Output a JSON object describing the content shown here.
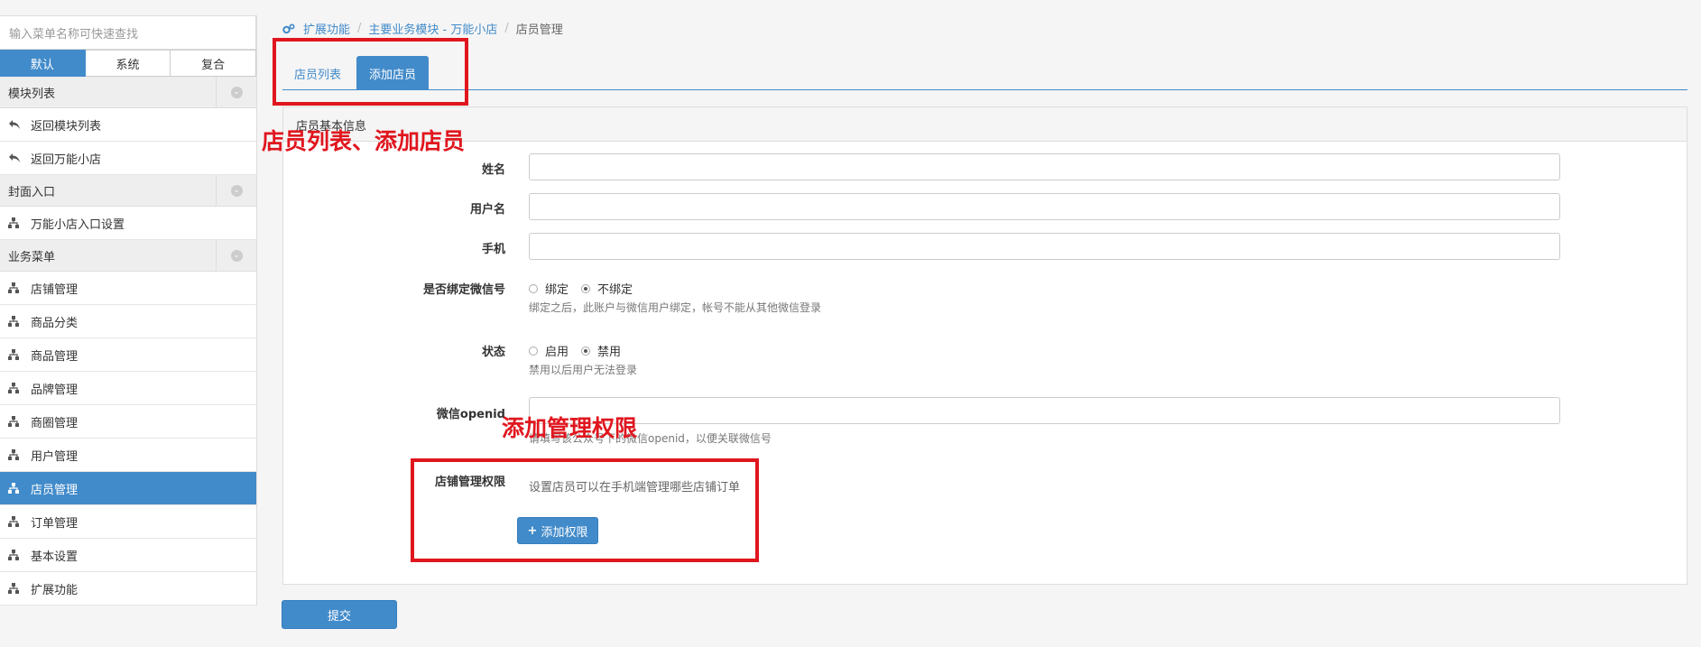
{
  "sidebar": {
    "search_placeholder": "输入菜单名称可快速查找",
    "mode_tabs": [
      "默认",
      "系统",
      "复合"
    ],
    "groups": [
      {
        "title": "模块列表",
        "items": [
          "返回模块列表",
          "返回万能小店"
        ]
      },
      {
        "title": "封面入口",
        "items": [
          "万能小店入口设置"
        ]
      },
      {
        "title": "业务菜单",
        "items": [
          "店铺管理",
          "商品分类",
          "商品管理",
          "品牌管理",
          "商圈管理",
          "用户管理",
          "店员管理",
          "订单管理",
          "基本设置",
          "扩展功能"
        ]
      }
    ]
  },
  "breadcrumb": {
    "items": [
      "扩展功能",
      "主要业务模块 - 万能小店"
    ],
    "current": "店员管理"
  },
  "tabs": [
    "店员列表",
    "添加店员"
  ],
  "panel": {
    "title": "店员基本信息",
    "labels": {
      "name": "姓名",
      "username": "用户名",
      "phone": "手机",
      "bind_wechat": "是否绑定微信号",
      "status": "状态",
      "openid": "微信openid",
      "perm": "店铺管理权限"
    },
    "bind_options": [
      "绑定",
      "不绑定"
    ],
    "bind_help": "绑定之后，此账户与微信用户绑定，帐号不能从其他微信登录",
    "status_options": [
      "启用",
      "禁用"
    ],
    "status_help": "禁用以后用户无法登录",
    "openid_help": "请填写该公众号下的微信openid，以便关联微信号",
    "perm_help": "设置店员可以在手机端管理哪些店铺订单",
    "add_perm_label": "添加权限"
  },
  "submit_label": "提交",
  "annotations": {
    "tabs_note": "店员列表、添加店员",
    "perm_note": "添加管理权限",
    "color": "#e0161e"
  },
  "colors": {
    "accent": "#428bca"
  }
}
